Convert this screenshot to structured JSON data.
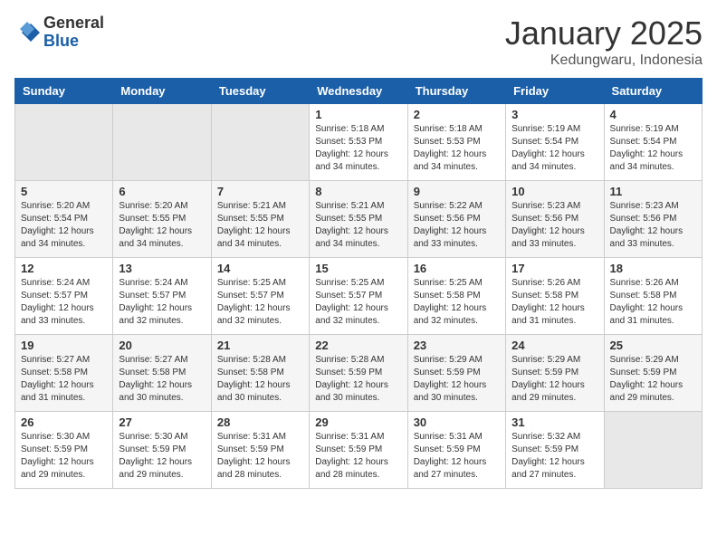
{
  "header": {
    "logo_general": "General",
    "logo_blue": "Blue",
    "month_title": "January 2025",
    "subtitle": "Kedungwaru, Indonesia"
  },
  "weekdays": [
    "Sunday",
    "Monday",
    "Tuesday",
    "Wednesday",
    "Thursday",
    "Friday",
    "Saturday"
  ],
  "weeks": [
    [
      {
        "day": "",
        "sunrise": "",
        "sunset": "",
        "daylight": ""
      },
      {
        "day": "",
        "sunrise": "",
        "sunset": "",
        "daylight": ""
      },
      {
        "day": "",
        "sunrise": "",
        "sunset": "",
        "daylight": ""
      },
      {
        "day": "1",
        "sunrise": "Sunrise: 5:18 AM",
        "sunset": "Sunset: 5:53 PM",
        "daylight": "Daylight: 12 hours and 34 minutes."
      },
      {
        "day": "2",
        "sunrise": "Sunrise: 5:18 AM",
        "sunset": "Sunset: 5:53 PM",
        "daylight": "Daylight: 12 hours and 34 minutes."
      },
      {
        "day": "3",
        "sunrise": "Sunrise: 5:19 AM",
        "sunset": "Sunset: 5:54 PM",
        "daylight": "Daylight: 12 hours and 34 minutes."
      },
      {
        "day": "4",
        "sunrise": "Sunrise: 5:19 AM",
        "sunset": "Sunset: 5:54 PM",
        "daylight": "Daylight: 12 hours and 34 minutes."
      }
    ],
    [
      {
        "day": "5",
        "sunrise": "Sunrise: 5:20 AM",
        "sunset": "Sunset: 5:54 PM",
        "daylight": "Daylight: 12 hours and 34 minutes."
      },
      {
        "day": "6",
        "sunrise": "Sunrise: 5:20 AM",
        "sunset": "Sunset: 5:55 PM",
        "daylight": "Daylight: 12 hours and 34 minutes."
      },
      {
        "day": "7",
        "sunrise": "Sunrise: 5:21 AM",
        "sunset": "Sunset: 5:55 PM",
        "daylight": "Daylight: 12 hours and 34 minutes."
      },
      {
        "day": "8",
        "sunrise": "Sunrise: 5:21 AM",
        "sunset": "Sunset: 5:55 PM",
        "daylight": "Daylight: 12 hours and 34 minutes."
      },
      {
        "day": "9",
        "sunrise": "Sunrise: 5:22 AM",
        "sunset": "Sunset: 5:56 PM",
        "daylight": "Daylight: 12 hours and 33 minutes."
      },
      {
        "day": "10",
        "sunrise": "Sunrise: 5:23 AM",
        "sunset": "Sunset: 5:56 PM",
        "daylight": "Daylight: 12 hours and 33 minutes."
      },
      {
        "day": "11",
        "sunrise": "Sunrise: 5:23 AM",
        "sunset": "Sunset: 5:56 PM",
        "daylight": "Daylight: 12 hours and 33 minutes."
      }
    ],
    [
      {
        "day": "12",
        "sunrise": "Sunrise: 5:24 AM",
        "sunset": "Sunset: 5:57 PM",
        "daylight": "Daylight: 12 hours and 33 minutes."
      },
      {
        "day": "13",
        "sunrise": "Sunrise: 5:24 AM",
        "sunset": "Sunset: 5:57 PM",
        "daylight": "Daylight: 12 hours and 32 minutes."
      },
      {
        "day": "14",
        "sunrise": "Sunrise: 5:25 AM",
        "sunset": "Sunset: 5:57 PM",
        "daylight": "Daylight: 12 hours and 32 minutes."
      },
      {
        "day": "15",
        "sunrise": "Sunrise: 5:25 AM",
        "sunset": "Sunset: 5:57 PM",
        "daylight": "Daylight: 12 hours and 32 minutes."
      },
      {
        "day": "16",
        "sunrise": "Sunrise: 5:25 AM",
        "sunset": "Sunset: 5:58 PM",
        "daylight": "Daylight: 12 hours and 32 minutes."
      },
      {
        "day": "17",
        "sunrise": "Sunrise: 5:26 AM",
        "sunset": "Sunset: 5:58 PM",
        "daylight": "Daylight: 12 hours and 31 minutes."
      },
      {
        "day": "18",
        "sunrise": "Sunrise: 5:26 AM",
        "sunset": "Sunset: 5:58 PM",
        "daylight": "Daylight: 12 hours and 31 minutes."
      }
    ],
    [
      {
        "day": "19",
        "sunrise": "Sunrise: 5:27 AM",
        "sunset": "Sunset: 5:58 PM",
        "daylight": "Daylight: 12 hours and 31 minutes."
      },
      {
        "day": "20",
        "sunrise": "Sunrise: 5:27 AM",
        "sunset": "Sunset: 5:58 PM",
        "daylight": "Daylight: 12 hours and 30 minutes."
      },
      {
        "day": "21",
        "sunrise": "Sunrise: 5:28 AM",
        "sunset": "Sunset: 5:58 PM",
        "daylight": "Daylight: 12 hours and 30 minutes."
      },
      {
        "day": "22",
        "sunrise": "Sunrise: 5:28 AM",
        "sunset": "Sunset: 5:59 PM",
        "daylight": "Daylight: 12 hours and 30 minutes."
      },
      {
        "day": "23",
        "sunrise": "Sunrise: 5:29 AM",
        "sunset": "Sunset: 5:59 PM",
        "daylight": "Daylight: 12 hours and 30 minutes."
      },
      {
        "day": "24",
        "sunrise": "Sunrise: 5:29 AM",
        "sunset": "Sunset: 5:59 PM",
        "daylight": "Daylight: 12 hours and 29 minutes."
      },
      {
        "day": "25",
        "sunrise": "Sunrise: 5:29 AM",
        "sunset": "Sunset: 5:59 PM",
        "daylight": "Daylight: 12 hours and 29 minutes."
      }
    ],
    [
      {
        "day": "26",
        "sunrise": "Sunrise: 5:30 AM",
        "sunset": "Sunset: 5:59 PM",
        "daylight": "Daylight: 12 hours and 29 minutes."
      },
      {
        "day": "27",
        "sunrise": "Sunrise: 5:30 AM",
        "sunset": "Sunset: 5:59 PM",
        "daylight": "Daylight: 12 hours and 29 minutes."
      },
      {
        "day": "28",
        "sunrise": "Sunrise: 5:31 AM",
        "sunset": "Sunset: 5:59 PM",
        "daylight": "Daylight: 12 hours and 28 minutes."
      },
      {
        "day": "29",
        "sunrise": "Sunrise: 5:31 AM",
        "sunset": "Sunset: 5:59 PM",
        "daylight": "Daylight: 12 hours and 28 minutes."
      },
      {
        "day": "30",
        "sunrise": "Sunrise: 5:31 AM",
        "sunset": "Sunset: 5:59 PM",
        "daylight": "Daylight: 12 hours and 27 minutes."
      },
      {
        "day": "31",
        "sunrise": "Sunrise: 5:32 AM",
        "sunset": "Sunset: 5:59 PM",
        "daylight": "Daylight: 12 hours and 27 minutes."
      },
      {
        "day": "",
        "sunrise": "",
        "sunset": "",
        "daylight": ""
      }
    ]
  ]
}
